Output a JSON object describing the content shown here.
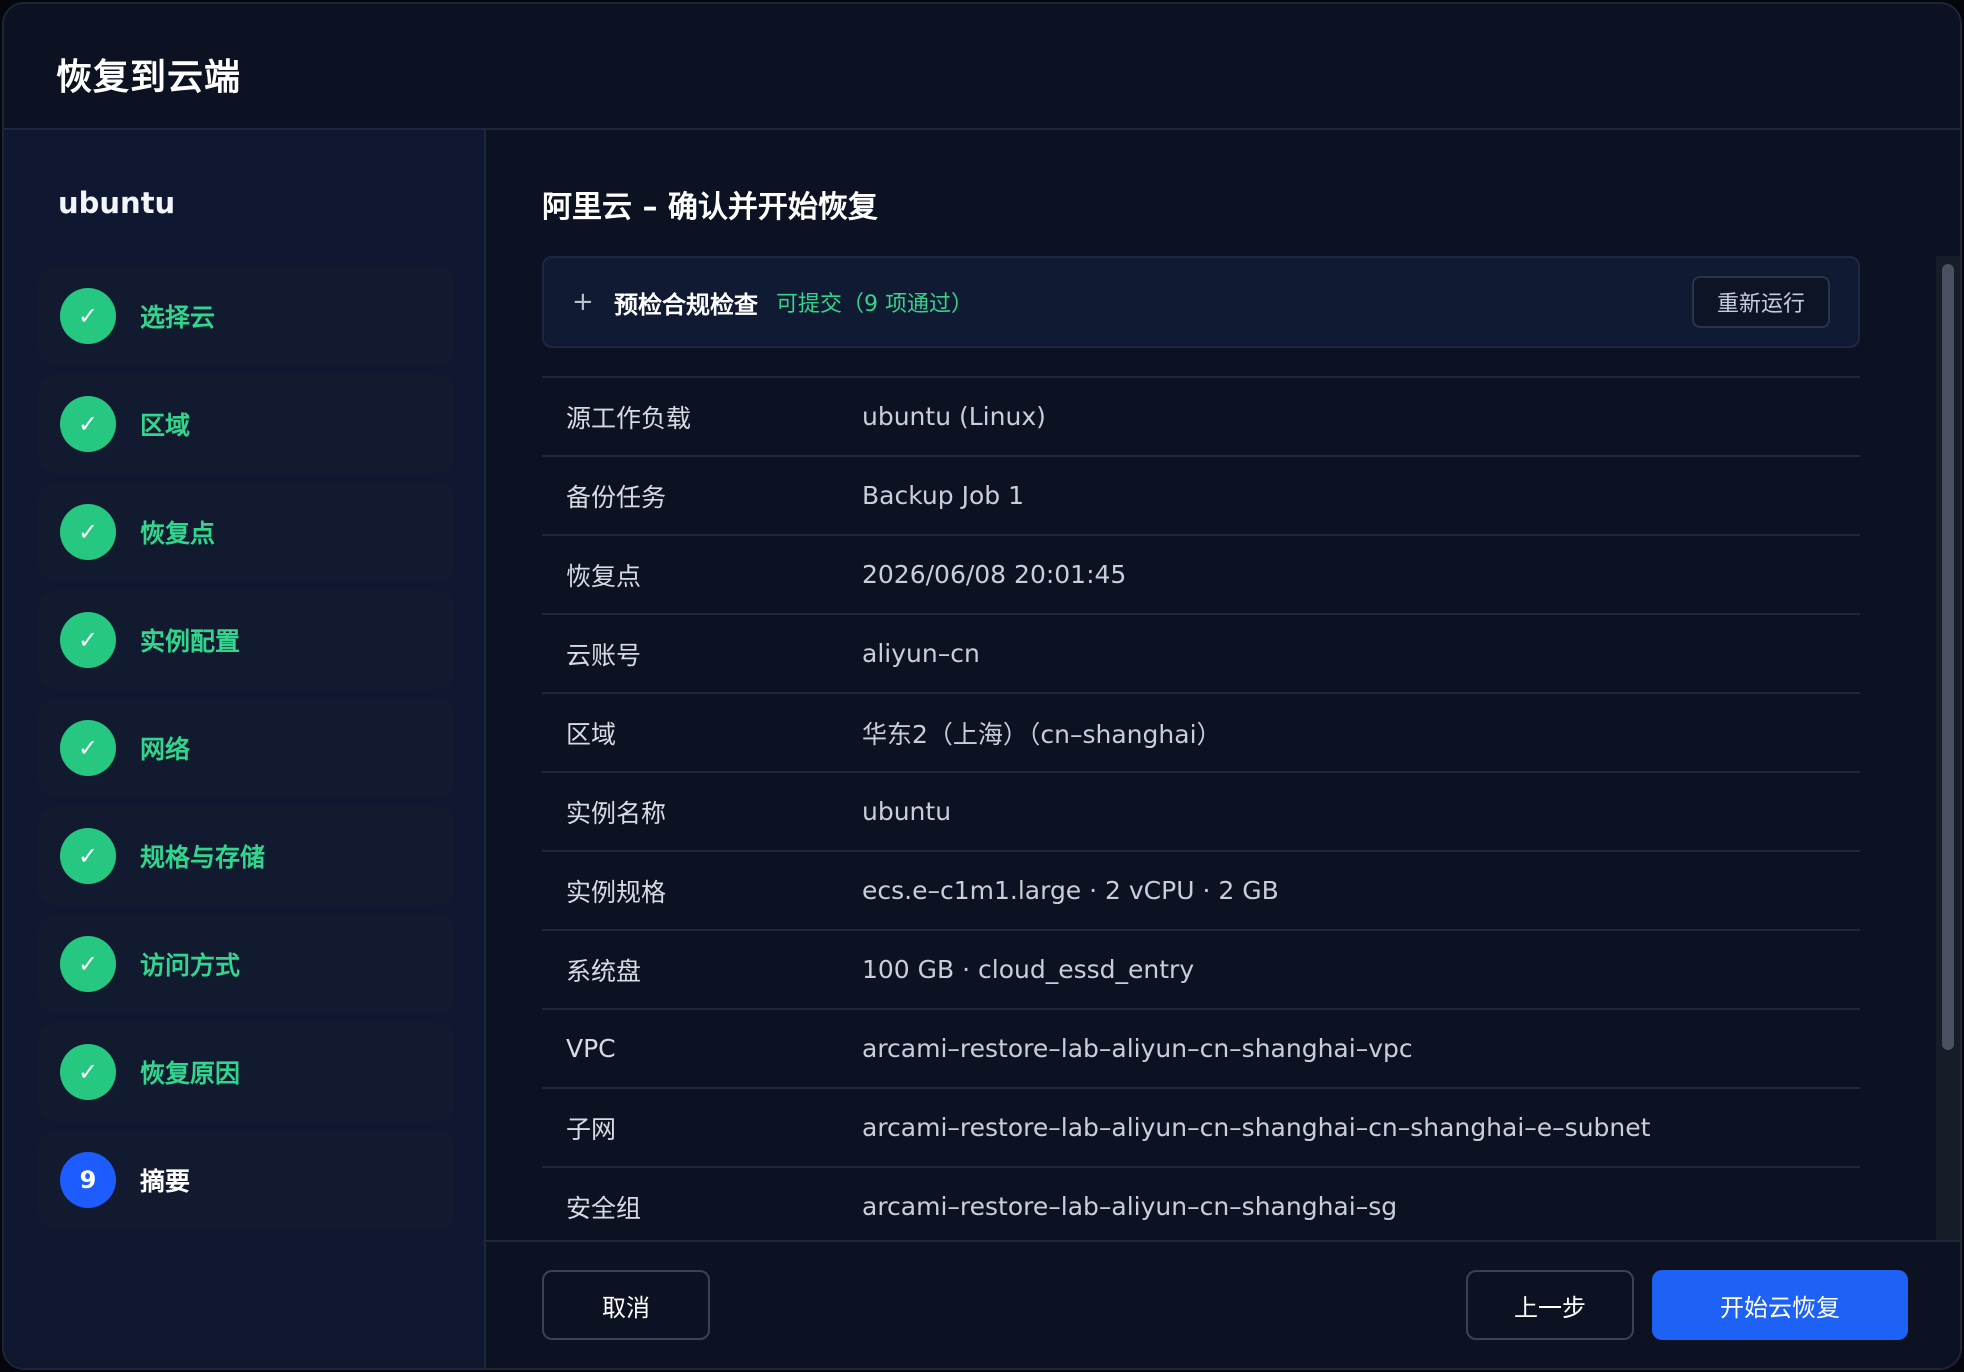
{
  "dialog": {
    "title": "恢复到云端"
  },
  "sidebar": {
    "workload_name": "ubuntu",
    "steps": [
      {
        "label": "选择云",
        "state": "done"
      },
      {
        "label": "区域",
        "state": "done"
      },
      {
        "label": "恢复点",
        "state": "done"
      },
      {
        "label": "实例配置",
        "state": "done"
      },
      {
        "label": "网络",
        "state": "done"
      },
      {
        "label": "规格与存储",
        "state": "done"
      },
      {
        "label": "访问方式",
        "state": "done"
      },
      {
        "label": "恢复原因",
        "state": "done"
      },
      {
        "label": "摘要",
        "state": "current",
        "number": "9"
      }
    ],
    "check_glyph": "✓"
  },
  "main": {
    "title": "阿里云 – 确认并开始恢复",
    "precheck": {
      "expand_icon": "+",
      "label": "预检合规检查",
      "status": "可提交（9 项通过）",
      "rerun_label": "重新运行"
    },
    "details": [
      {
        "key": "源工作负载",
        "value": "ubuntu (Linux)"
      },
      {
        "key": "备份任务",
        "value": "Backup Job 1"
      },
      {
        "key": "恢复点",
        "value": "2026/06/08 20:01:45"
      },
      {
        "key": "云账号",
        "value": "aliyun–cn"
      },
      {
        "key": "区域",
        "value": "华东2（上海）（cn–shanghai）"
      },
      {
        "key": "实例名称",
        "value": "ubuntu"
      },
      {
        "key": "实例规格",
        "value": "ecs.e–c1m1.large · 2 vCPU · 2 GB"
      },
      {
        "key": "系统盘",
        "value": "100 GB · cloud_essd_entry"
      },
      {
        "key": "VPC",
        "value": "arcami–restore–lab–aliyun–cn–shanghai–vpc"
      },
      {
        "key": "子网",
        "value": "arcami–restore–lab–aliyun–cn–shanghai–cn–shanghai–e–subnet"
      },
      {
        "key": "安全组",
        "value": "arcami–restore–lab–aliyun–cn–shanghai–sg"
      }
    ]
  },
  "footer": {
    "cancel_label": "取消",
    "prev_label": "上一步",
    "start_label": "开始云恢复"
  },
  "colors": {
    "success": "#26c781",
    "success_text": "#33d48d",
    "accent": "#1d62f5",
    "background": "#0c1222"
  }
}
